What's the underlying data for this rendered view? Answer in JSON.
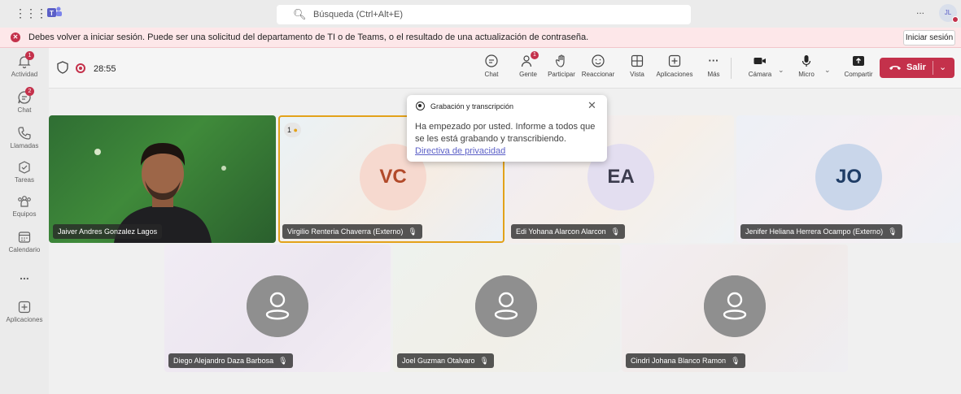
{
  "titlebar": {
    "search_placeholder": "Búsqueda (Ctrl+Alt+E)",
    "more_label": "...",
    "avatar_initials": "JL"
  },
  "banner": {
    "message": "Debes volver a iniciar sesión. Puede ser una solicitud del departamento de TI o de Teams, o el resultado de una actualización de contraseña.",
    "button_label": "Iniciar sesión"
  },
  "rail": {
    "items": [
      {
        "label": "Actividad",
        "icon": "bell-icon",
        "badge": "1"
      },
      {
        "label": "Chat",
        "icon": "chat-icon",
        "badge": "2"
      },
      {
        "label": "Llamadas",
        "icon": "phone-icon"
      },
      {
        "label": "Tareas",
        "icon": "tasks-icon"
      },
      {
        "label": "Equipos",
        "icon": "teams-icon"
      },
      {
        "label": "Calendario",
        "icon": "calendar-icon"
      },
      {
        "label": "...",
        "icon": "more-icon"
      },
      {
        "label": "Aplicaciones",
        "icon": "add-apps-icon"
      }
    ]
  },
  "toolbar": {
    "timer": "28:55",
    "buttons": {
      "chat": "Chat",
      "people": "Gente",
      "people_badge": "1",
      "raise": "Participar",
      "react": "Reaccionar",
      "view": "Vista",
      "apps": "Aplicaciones",
      "more": "Más",
      "camera": "Cámara",
      "mic": "Micro",
      "share": "Compartir"
    },
    "leave_label": "Salir"
  },
  "participants": [
    {
      "name": "Jaiver Andres Gonzalez Lagos",
      "type": "video"
    },
    {
      "name": "Virgilio Renteria Chaverra (Externo)",
      "initials": "VC",
      "hand_raised": "1"
    },
    {
      "name": "Edi Yohana Alarcon Alarcon",
      "initials": "EA"
    },
    {
      "name": "Jenifer Heliana Herrera Ocampo (Externo)",
      "initials": "JO"
    },
    {
      "name": "Diego Alejandro Daza Barbosa"
    },
    {
      "name": "Joel Guzman Otalvaro"
    },
    {
      "name": "Cindri Johana Blanco Ramon"
    }
  ],
  "popup": {
    "title": "Grabación y transcripción",
    "body": "Ha empezado por usted. Informe a todos que se les está grabando y transcribiendo. ",
    "link": "Directiva de privacidad"
  },
  "colors": {
    "accent": "#5b5fc7",
    "danger": "#c4314b",
    "speaking_border": "#e3a21a"
  }
}
